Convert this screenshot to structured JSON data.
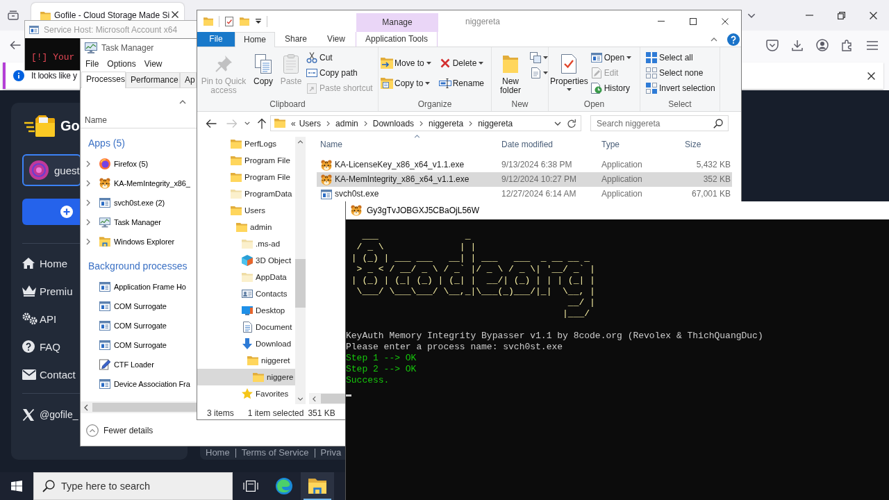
{
  "browser": {
    "tab": {
      "title": "Gofile - Cloud Storage Made Si"
    },
    "notification": {
      "text": "It looks like y"
    },
    "page": {
      "logo_text": "Go",
      "account": {
        "name": "guest"
      },
      "menu": [
        {
          "label": "Home",
          "kind": "home"
        },
        {
          "label": "Premiu",
          "kind": "crown"
        },
        {
          "label": "API",
          "kind": "gears"
        },
        {
          "label": "FAQ",
          "kind": "help"
        },
        {
          "label": "Contact",
          "kind": "mail"
        }
      ],
      "social": {
        "handle": "@gofile_"
      },
      "footer_links": [
        "Home",
        "Terms of Service",
        "Priva"
      ]
    }
  },
  "service_host": {
    "title": "Service Host: Microsoft Account x64",
    "output": "[!] Your"
  },
  "task_manager": {
    "title": "Task Manager",
    "menu": [
      "File",
      "Options",
      "View"
    ],
    "tabs": [
      {
        "label": "Processes",
        "selected": true
      },
      {
        "label": "Performance",
        "selected": false
      },
      {
        "label": "Ap",
        "selected": false
      }
    ],
    "column": "Name",
    "sections": [
      {
        "title": "Apps (5)",
        "processes": [
          {
            "name": "Firefox (5)",
            "kind": "browser",
            "expanded": false
          },
          {
            "name": "KA-MemIntegrity_x86_",
            "kind": "mascot",
            "expanded": false
          },
          {
            "name": "svch0st.exe (2)",
            "kind": "window",
            "expanded": false
          },
          {
            "name": "Task Manager",
            "kind": "monitor",
            "expanded": false
          },
          {
            "name": "Windows Explorer",
            "kind": "explorer",
            "expanded": false
          }
        ]
      },
      {
        "title": "Background processes",
        "processes": [
          {
            "name": "Application Frame Ho",
            "kind": "window"
          },
          {
            "name": "COM Surrogate",
            "kind": "window"
          },
          {
            "name": "COM Surrogate",
            "kind": "window"
          },
          {
            "name": "COM Surrogate",
            "kind": "window"
          },
          {
            "name": "CTF Loader",
            "kind": "pen"
          },
          {
            "name": "Device Association Fra",
            "kind": "window"
          }
        ]
      }
    ],
    "footer": "Fewer details"
  },
  "explorer": {
    "title": "niggereta",
    "context_tab": "Manage",
    "ribbon_tabs": [
      {
        "label": "File",
        "kind": "file",
        "selected": false
      },
      {
        "label": "Home",
        "kind": "plain",
        "selected": true
      },
      {
        "label": "Share",
        "kind": "plain",
        "selected": false
      },
      {
        "label": "View",
        "kind": "plain",
        "selected": false
      },
      {
        "label": "Application Tools",
        "kind": "context",
        "selected": false
      }
    ],
    "ribbon_groups": [
      {
        "label": "Clipboard",
        "commands": [
          {
            "label": "Pin to Quick access",
            "kind": "large",
            "disabled": true,
            "dropdown": false
          },
          {
            "label": "Copy",
            "kind": "large",
            "disabled": false,
            "dropdown": false
          },
          {
            "label": "Paste",
            "kind": "large",
            "disabled": true,
            "dropdown": false
          },
          {
            "label": "Cut",
            "kind": "small",
            "disabled": false,
            "dropdown": false
          },
          {
            "label": "Copy path",
            "kind": "small",
            "disabled": false,
            "dropdown": false
          },
          {
            "label": "Paste shortcut",
            "kind": "small",
            "disabled": true,
            "dropdown": false
          }
        ]
      },
      {
        "label": "Organize",
        "commands": [
          {
            "label": "Move to",
            "kind": "small",
            "disabled": false,
            "dropdown": true
          },
          {
            "label": "Copy to",
            "kind": "small",
            "disabled": false,
            "dropdown": true
          },
          {
            "label": "Delete",
            "kind": "small",
            "disabled": false,
            "dropdown": true
          },
          {
            "label": "Rename",
            "kind": "small",
            "disabled": false,
            "dropdown": false
          }
        ]
      },
      {
        "label": "New",
        "commands": [
          {
            "label": "New folder",
            "kind": "large",
            "disabled": false,
            "dropdown": false
          },
          {
            "kind": "icon",
            "disabled": false,
            "dropdown": true
          },
          {
            "kind": "icon",
            "disabled": false,
            "dropdown": true
          }
        ]
      },
      {
        "label": "Open",
        "commands": [
          {
            "label": "Properties",
            "kind": "large",
            "disabled": false,
            "dropdown": true
          },
          {
            "label": "Open",
            "kind": "small",
            "disabled": false,
            "dropdown": true
          },
          {
            "label": "Edit",
            "kind": "small",
            "disabled": true,
            "dropdown": false
          },
          {
            "label": "History",
            "kind": "small",
            "disabled": false,
            "dropdown": false
          }
        ]
      },
      {
        "label": "Select",
        "commands": [
          {
            "label": "Select all",
            "kind": "small",
            "disabled": false,
            "dropdown": false
          },
          {
            "label": "Select none",
            "kind": "small",
            "disabled": false,
            "dropdown": false
          },
          {
            "label": "Invert selection",
            "kind": "small",
            "disabled": false,
            "dropdown": false
          }
        ]
      }
    ],
    "address": {
      "prefix": "«",
      "path": [
        "Users",
        "admin",
        "Downloads",
        "niggereta",
        "niggereta"
      ]
    },
    "search": {
      "placeholder": "Search niggereta"
    },
    "tree": [
      {
        "label": "PerfLogs",
        "kind": "folder",
        "selected": false
      },
      {
        "label": "Program File",
        "kind": "folder",
        "selected": false
      },
      {
        "label": "Program File",
        "kind": "folder",
        "selected": false
      },
      {
        "label": "ProgramData",
        "kind": "faded",
        "selected": false
      },
      {
        "label": "Users",
        "kind": "folder",
        "selected": false,
        "children": [
          {
            "label": "admin",
            "kind": "folder",
            "selected": false,
            "children": [
              {
                "label": ".ms-ad",
                "kind": "faded",
                "selected": false
              },
              {
                "label": "3D Object",
                "kind": "cube",
                "selected": false
              },
              {
                "label": "AppData",
                "kind": "faded",
                "selected": false
              },
              {
                "label": "Contacts",
                "kind": "contacts",
                "selected": false
              },
              {
                "label": "Desktop",
                "kind": "desktop",
                "selected": false
              },
              {
                "label": "Document",
                "kind": "documents",
                "selected": false
              },
              {
                "label": "Download",
                "kind": "downloads",
                "selected": false,
                "children": [
                  {
                    "label": "niggeret",
                    "kind": "folder",
                    "selected": false,
                    "children": [
                      {
                        "label": "niggere",
                        "kind": "folder",
                        "selected": true
                      }
                    ]
                  }
                ]
              },
              {
                "label": "Favorites",
                "kind": "star",
                "selected": false
              }
            ]
          }
        ]
      }
    ],
    "columns": [
      "Name",
      "Date modified",
      "Type",
      "Size"
    ],
    "files": [
      {
        "name": "KA-LicenseKey_x86_x64_v1.1.exe",
        "kind": "mascot",
        "date": "9/13/2024 6:38 PM",
        "type": "Application",
        "size": "5,432 KB",
        "selected": false
      },
      {
        "name": "KA-MemIntegrity_x86_x64_v1.1.exe",
        "kind": "mascot",
        "date": "9/12/2024 10:27 PM",
        "type": "Application",
        "size": "352 KB",
        "selected": true
      },
      {
        "name": "svch0st.exe",
        "kind": "window",
        "date": "12/27/2024 6:14 AM",
        "type": "Application",
        "size": "67,001 KB",
        "selected": false
      }
    ],
    "status": {
      "count": "3 items",
      "selection": "1 item selected",
      "size": "351 KB"
    }
  },
  "console": {
    "title": "Gy3gTvJOBGXJ5CBaOjL56W",
    "banner": "   ___                _\n  / _ \\              | |\n | (_) | ___ ___   __| | ___   ___  _ __ __ _\n  > _ < / __/ _ \\ / _` |/ _ \\ / _ \\| '__/ _` |\n | (_) | (_| (_) | (_| |  __/| (_) | | | (_| |\n  \\___/ \\___\\___/ \\__,_|\\___(_)___/|_|  \\__, |\n                                         __/ |\n                                        |___/",
    "lines": [
      {
        "text": "KeyAuth Memory Integrity Bypasser v1.1 by 8code.org (Revolex & ThichQuangDuc)",
        "color": "#cccccc"
      },
      {
        "text": "Please enter a process name: svch0st.exe",
        "color": "#cccccc"
      },
      {
        "text": "Step 1 --> OK",
        "color": "#16c60c"
      },
      {
        "text": "Step 2 --> OK",
        "color": "#16c60c"
      },
      {
        "text": "Success.",
        "color": "#16c60c"
      }
    ]
  },
  "taskbar": {
    "search": {
      "placeholder": "Type here to search"
    },
    "apps": [
      {
        "kind": "taskview",
        "active": false
      },
      {
        "kind": "browser",
        "active": false
      },
      {
        "kind": "folder",
        "active": true
      }
    ]
  }
}
